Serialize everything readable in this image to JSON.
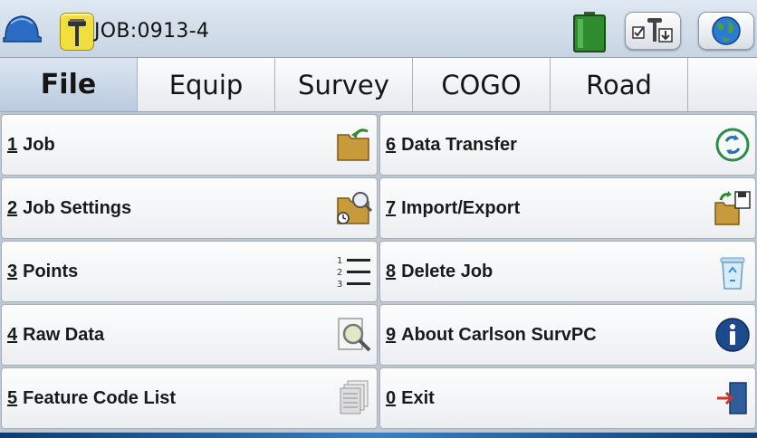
{
  "titlebar": {
    "job_title": "JOB:0913-4",
    "icons": [
      "helmet-icon",
      "gps-rover-icon",
      "battery-icon",
      "device-settings-icon",
      "globe-icon"
    ]
  },
  "tabs": [
    {
      "label": "File",
      "active": true
    },
    {
      "label": "Equip",
      "active": false
    },
    {
      "label": "Survey",
      "active": false
    },
    {
      "label": "COGO",
      "active": false
    },
    {
      "label": "Road",
      "active": false
    }
  ],
  "menu": {
    "items": [
      {
        "num": "1",
        "label": "Job",
        "icon": "folder-open-icon"
      },
      {
        "num": "2",
        "label": "Job Settings",
        "icon": "folder-settings-icon"
      },
      {
        "num": "3",
        "label": "Points",
        "icon": "numbered-list-icon"
      },
      {
        "num": "4",
        "label": "Raw Data",
        "icon": "magnify-document-icon"
      },
      {
        "num": "5",
        "label": "Feature Code List",
        "icon": "stacked-pages-icon"
      },
      {
        "num": "6",
        "label": "Data Transfer",
        "icon": "sync-icon"
      },
      {
        "num": "7",
        "label": "Import/Export",
        "icon": "import-export-icon"
      },
      {
        "num": "8",
        "label": "Delete Job",
        "icon": "recycle-bin-icon"
      },
      {
        "num": "9",
        "label": "About Carlson SurvPC",
        "icon": "info-icon"
      },
      {
        "num": "0",
        "label": "Exit",
        "icon": "exit-door-icon"
      }
    ]
  },
  "colors": {
    "accent": "#2e7d32",
    "tab_active": "#b9cbe0",
    "battery": "#2e8b2e"
  }
}
